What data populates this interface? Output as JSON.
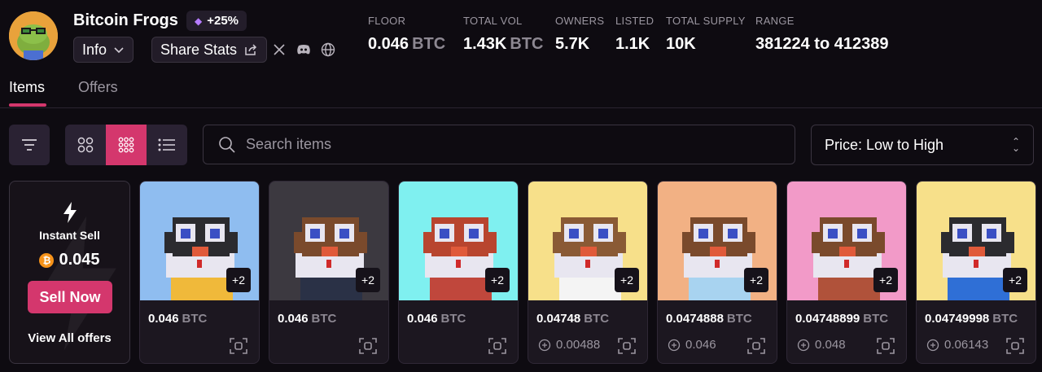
{
  "collection": {
    "name": "Bitcoin Frogs",
    "boost": "+25%",
    "info_label": "Info",
    "share_label": "Share Stats"
  },
  "stats": [
    {
      "label": "FLOOR",
      "value": "0.046",
      "unit": "BTC"
    },
    {
      "label": "TOTAL VOL",
      "value": "1.43K",
      "unit": "BTC"
    },
    {
      "label": "OWNERS",
      "value": "5.7K",
      "unit": ""
    },
    {
      "label": "LISTED",
      "value": "1.1K",
      "unit": ""
    },
    {
      "label": "TOTAL SUPPLY",
      "value": "10K",
      "unit": ""
    },
    {
      "label": "RANGE",
      "value": "381224 to 412389",
      "unit": ""
    }
  ],
  "tabs": [
    {
      "label": "Items",
      "active": true
    },
    {
      "label": "Offers",
      "active": false
    }
  ],
  "search": {
    "placeholder": "Search items"
  },
  "sort": {
    "selected": "Price: Low to High"
  },
  "instant_sell": {
    "label": "Instant Sell",
    "price": "0.045",
    "button": "Sell Now",
    "view_all": "View All offers"
  },
  "items": [
    {
      "price": "0.046",
      "unit": "BTC",
      "extra": "+2",
      "last_price": "",
      "bg": "#8fbdf0"
    },
    {
      "price": "0.046",
      "unit": "BTC",
      "extra": "+2",
      "last_price": "",
      "bg": "#3c3940"
    },
    {
      "price": "0.046",
      "unit": "BTC",
      "extra": "+2",
      "last_price": "",
      "bg": "#7ff0f0"
    },
    {
      "price": "0.04748",
      "unit": "BTC",
      "extra": "+2",
      "last_price": "0.00488",
      "bg": "#f7e08a"
    },
    {
      "price": "0.0474888",
      "unit": "BTC",
      "extra": "+2",
      "last_price": "0.046",
      "bg": "#f2b184"
    },
    {
      "price": "0.04748899",
      "unit": "BTC",
      "extra": "+2",
      "last_price": "0.048",
      "bg": "#f29ac8"
    },
    {
      "price": "0.04749998",
      "unit": "BTC",
      "extra": "+2",
      "last_price": "0.06143",
      "bg": "#f7e08a"
    }
  ],
  "colors": {
    "accent": "#d4376d",
    "background": "#0e0b11",
    "btc": "#f7931a"
  },
  "icons": [
    "filter-icon",
    "grid-large-icon",
    "grid-small-icon",
    "list-icon",
    "search-icon",
    "bolt-icon",
    "scan-icon",
    "x-icon",
    "discord-icon",
    "globe-icon",
    "share-icon",
    "chevron-down-icon"
  ]
}
